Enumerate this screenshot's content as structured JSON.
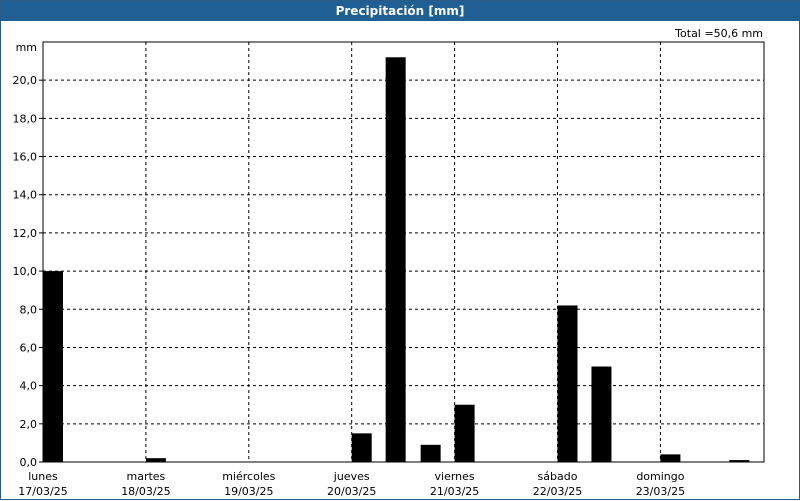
{
  "window": {
    "title": "Precipitación [mm]"
  },
  "summary": {
    "total": "Total =50,6 mm"
  },
  "colors": {
    "titlebar": "#1f5f94",
    "bars": "#000000",
    "grid": "#000000"
  },
  "chart_data": {
    "type": "bar",
    "title": "Precipitación [mm]",
    "ylabel": "mm",
    "ylim": [
      0,
      22
    ],
    "yticks": [
      "0,0",
      "2,0",
      "4,0",
      "6,0",
      "8,0",
      "10,0",
      "12,0",
      "14,0",
      "16,0",
      "18,0",
      "20,0"
    ],
    "day_labels": [
      {
        "day": "lunes",
        "date": "17/03/25"
      },
      {
        "day": "martes",
        "date": "18/03/25"
      },
      {
        "day": "miércoles",
        "date": "19/03/25"
      },
      {
        "day": "jueves",
        "date": "20/03/25"
      },
      {
        "day": "viernes",
        "date": "21/03/25"
      },
      {
        "day": "sábado",
        "date": "22/03/25"
      },
      {
        "day": "domingo",
        "date": "23/03/25"
      }
    ],
    "x_unit": "day index (0 = 17/03/25 00:00)",
    "bars": [
      {
        "x": 0.0,
        "value": 10.0
      },
      {
        "x": 1.0,
        "value": 0.2
      },
      {
        "x": 2.0,
        "value": 0.0
      },
      {
        "x": 3.0,
        "value": 1.5
      },
      {
        "x": 3.33,
        "value": 21.2
      },
      {
        "x": 3.67,
        "value": 0.9
      },
      {
        "x": 4.0,
        "value": 3.0
      },
      {
        "x": 5.0,
        "value": 8.2
      },
      {
        "x": 5.33,
        "value": 5.0
      },
      {
        "x": 6.0,
        "value": 0.4
      },
      {
        "x": 6.67,
        "value": 0.1
      }
    ],
    "grid": true
  }
}
